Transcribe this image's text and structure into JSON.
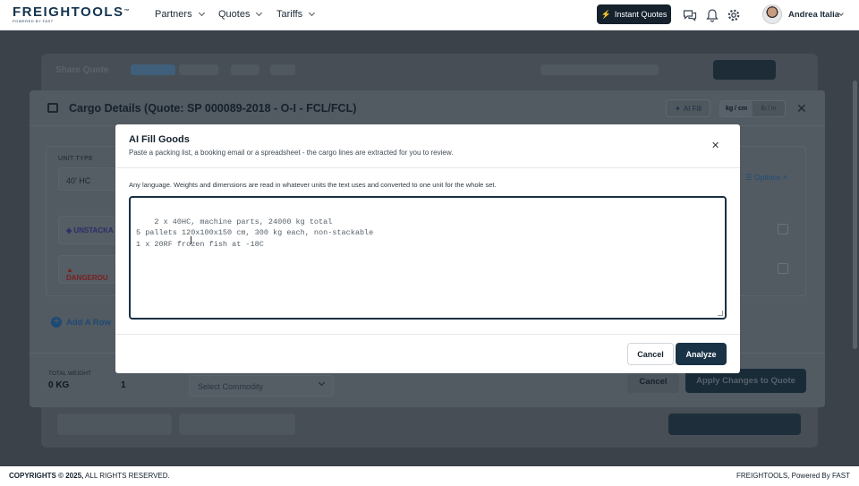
{
  "brand": {
    "name": "FREIGHTOOLS",
    "tm": "™",
    "tagline": "POWERED BY FAST"
  },
  "nav": {
    "items": [
      {
        "label": "Partners"
      },
      {
        "label": "Quotes"
      },
      {
        "label": "Tariffs"
      }
    ]
  },
  "header": {
    "instant_quotes": "Instant Quotes",
    "user_name": "Andrea Italia"
  },
  "background": {
    "share_title": "Share Quote"
  },
  "cargo": {
    "title": "Cargo Details (Quote: SP 000089-2018 - O-I - FCL/FCL)",
    "ai_fill": "AI Fill",
    "unit_options": [
      "kg / cm",
      "lb / in"
    ],
    "unit_type_label": "UNIT TYPE",
    "unit_type_value": "40' HC",
    "options_label": "Options",
    "unstackable_label": "UNSTACKA",
    "dangerous_label": "DANGEROU",
    "add_row": "Add A Row",
    "total_weight_label": "TOTAL WEIGHT",
    "total_weight_value": "0 KG",
    "total_qty_value": "1",
    "commodity_placeholder": "Select Commodity",
    "cancel": "Cancel",
    "apply": "Apply Changes to Quote"
  },
  "modal": {
    "title": "AI Fill Goods",
    "subtitle": "Paste a packing list, a booking email or a spreadsheet - the cargo lines are extracted for you to review.",
    "hint": "Any language. Weights and dimensions are read in whatever units the text uses and converted to one unit for the whole set.",
    "placeholder": "2 x 40HC, machine parts, 24000 kg total\n5 pallets 120x100x150 cm, 300 kg each, non-stackable\n1 x 20RF frozen fish at -18C",
    "cancel": "Cancel",
    "analyze": "Analyze"
  },
  "footer": {
    "copyright_prefix": "COPYRIGHTS © 2025,",
    "copyright_rest": " ALL RIGHTS RESERVED.",
    "right_brand": "FREIGHTOOLS,",
    "right_rest": " Powered By FAST"
  },
  "colors": {
    "primary": "#1a3246",
    "accent_link": "#1e4a75",
    "overlay": "#3b4249"
  }
}
